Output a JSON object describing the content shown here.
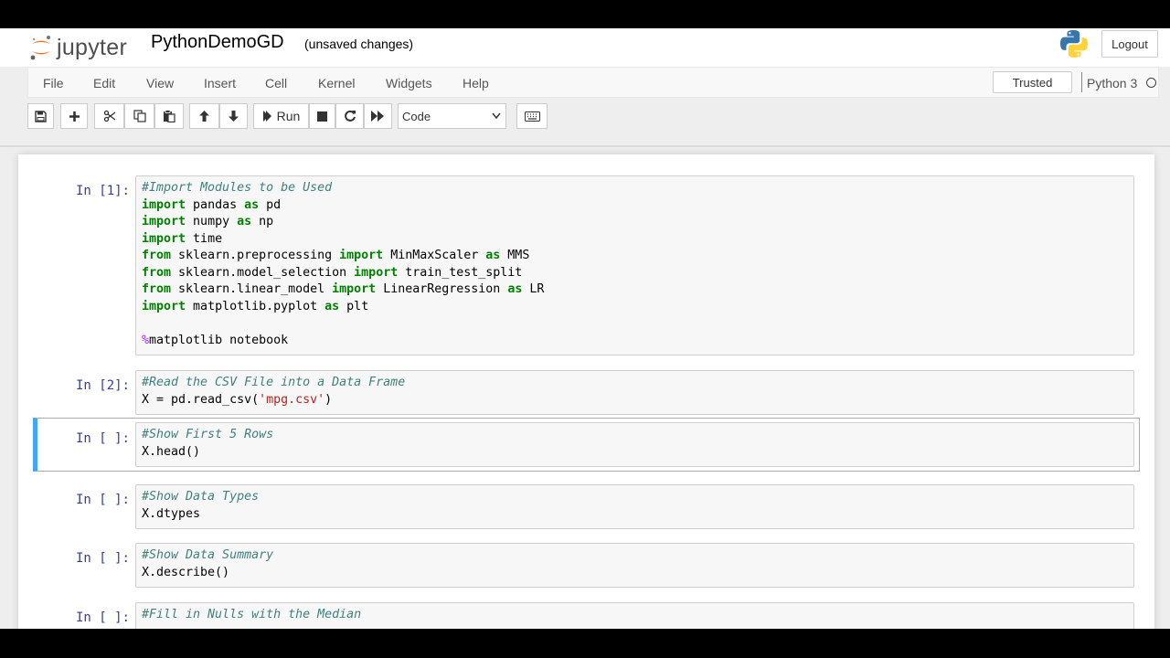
{
  "header": {
    "logo_text": "jupyter",
    "notebook_name": "PythonDemoGD",
    "save_status": "(unsaved changes)",
    "logout_label": "Logout"
  },
  "menubar": {
    "items": [
      "File",
      "Edit",
      "View",
      "Insert",
      "Cell",
      "Kernel",
      "Widgets",
      "Help"
    ],
    "trusted_label": "Trusted",
    "kernel_name": "Python 3"
  },
  "toolbar": {
    "run_label": "Run",
    "cell_type": "Code",
    "icons": [
      "save-icon",
      "plus-icon",
      "cut-icon",
      "copy-icon",
      "paste-icon",
      "arrow-up-icon",
      "arrow-down-icon",
      "run-icon",
      "stop-icon",
      "restart-icon",
      "fast-forward-icon",
      "keyboard-icon"
    ]
  },
  "colors": {
    "prompt": "#303f9f",
    "selected_border": "#42a5f5",
    "comment": "#408080",
    "keyword": "#008000",
    "string": "#ba2121",
    "magic": "#aa22ff"
  },
  "cells": [
    {
      "prompt": "In [1]:",
      "lines": [
        [
          [
            "cm",
            "#Import Modules to be Used"
          ]
        ],
        [
          [
            "kw",
            "import"
          ],
          [
            "",
            " pandas "
          ],
          [
            "kw",
            "as"
          ],
          [
            "",
            " pd"
          ]
        ],
        [
          [
            "kw",
            "import"
          ],
          [
            "",
            " numpy "
          ],
          [
            "kw",
            "as"
          ],
          [
            "",
            " np"
          ]
        ],
        [
          [
            "kw",
            "import"
          ],
          [
            "",
            " time"
          ]
        ],
        [
          [
            "kw",
            "from"
          ],
          [
            "",
            " sklearn.preprocessing "
          ],
          [
            "kw",
            "import"
          ],
          [
            "",
            " MinMaxScaler "
          ],
          [
            "kw",
            "as"
          ],
          [
            "",
            " MMS"
          ]
        ],
        [
          [
            "kw",
            "from"
          ],
          [
            "",
            " sklearn.model_selection "
          ],
          [
            "kw",
            "import"
          ],
          [
            "",
            " train_test_split"
          ]
        ],
        [
          [
            "kw",
            "from"
          ],
          [
            "",
            " sklearn.linear_model "
          ],
          [
            "kw",
            "import"
          ],
          [
            "",
            " LinearRegression "
          ],
          [
            "kw",
            "as"
          ],
          [
            "",
            " LR"
          ]
        ],
        [
          [
            "kw",
            "import"
          ],
          [
            "",
            " matplotlib.pyplot "
          ],
          [
            "kw",
            "as"
          ],
          [
            "",
            " plt"
          ]
        ],
        [
          [
            "",
            ""
          ]
        ],
        [
          [
            "mg",
            "%"
          ],
          [
            "",
            "matplotlib notebook"
          ]
        ]
      ]
    },
    {
      "prompt": "In [2]:",
      "lines": [
        [
          [
            "cm",
            "#Read the CSV File into a Data Frame"
          ]
        ],
        [
          [
            "",
            "X = pd.read_csv("
          ],
          [
            "st",
            "'mpg.csv'"
          ],
          [
            "",
            ")"
          ]
        ]
      ]
    },
    {
      "prompt": "In [ ]:",
      "selected": true,
      "lines": [
        [
          [
            "cm",
            "#Show First 5 Rows"
          ]
        ],
        [
          [
            "",
            "X.head()"
          ]
        ]
      ]
    },
    {
      "prompt": "In [ ]:",
      "lines": [
        [
          [
            "cm",
            "#Show Data Types"
          ]
        ],
        [
          [
            "",
            "X.dtypes"
          ]
        ]
      ]
    },
    {
      "prompt": "In [ ]:",
      "lines": [
        [
          [
            "cm",
            "#Show Data Summary"
          ]
        ],
        [
          [
            "",
            "X.describe()"
          ]
        ]
      ]
    },
    {
      "prompt": "In [ ]:",
      "lines": [
        [
          [
            "cm",
            "#Fill in Nulls with the Median"
          ]
        ]
      ]
    }
  ]
}
